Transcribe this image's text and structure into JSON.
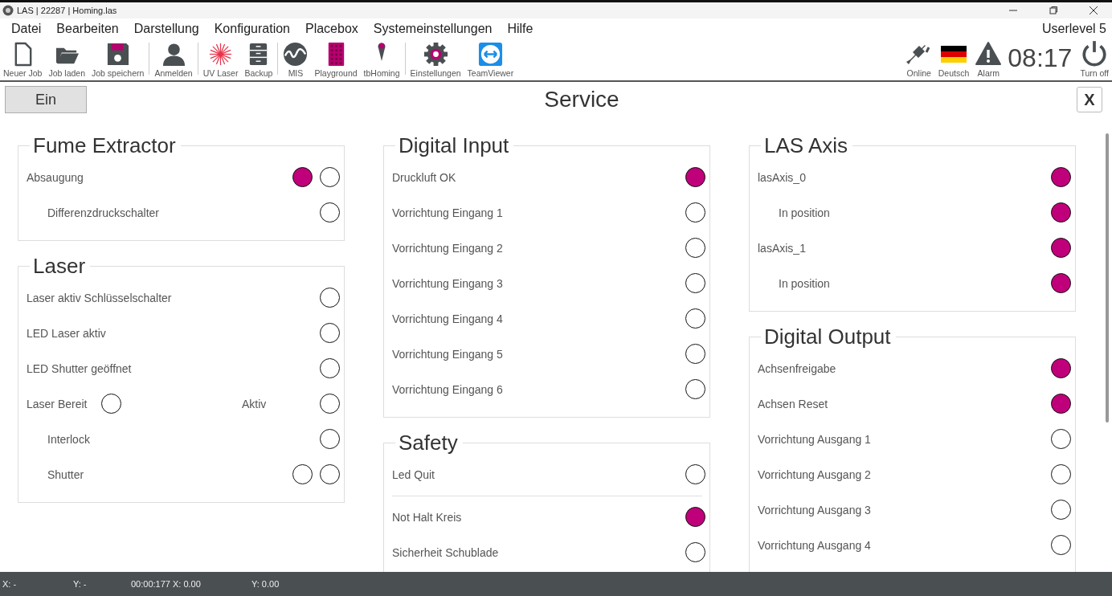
{
  "window": {
    "title": "LAS | 22287 | Homing.las"
  },
  "menu": [
    {
      "label": "Datei"
    },
    {
      "label": "Bearbeiten"
    },
    {
      "label": "Darstellung"
    },
    {
      "label": "Konfiguration"
    },
    {
      "label": "Placebox"
    },
    {
      "label": "Systemeinstellungen"
    },
    {
      "label": "Hilfe"
    }
  ],
  "userlevel": "Userlevel 5",
  "toolbar_groups": [
    [
      {
        "kind": "new",
        "label": "Neuer Job"
      },
      {
        "kind": "open",
        "label": "Job laden"
      },
      {
        "kind": "save",
        "label": "Job speichern"
      }
    ],
    [
      {
        "kind": "user",
        "label": "Anmelden"
      }
    ],
    [
      {
        "kind": "laser",
        "label": "UV Laser"
      },
      {
        "kind": "cabinet",
        "label": "Backup"
      }
    ],
    [
      {
        "kind": "mis",
        "label": "MIS"
      },
      {
        "kind": "grid",
        "label": "Playground"
      },
      {
        "kind": "pin",
        "label": "tbHoming"
      }
    ],
    [
      {
        "kind": "gear",
        "label": "Einstellungen"
      },
      {
        "kind": "remote",
        "label": "TeamViewer"
      }
    ]
  ],
  "status_icons": [
    {
      "kind": "online",
      "label": "Online"
    },
    {
      "kind": "flag",
      "label": "Deutsch"
    },
    {
      "kind": "alarm",
      "label": "Alarm"
    }
  ],
  "clock": "08:17",
  "turn_off": {
    "label": "Turn off"
  },
  "header": {
    "toggle": "Ein",
    "title": "Service",
    "close": "X"
  },
  "columns": [
    {
      "panels": [
        {
          "title": "Fume Extractor",
          "rows": [
            {
              "label": "Absaugung",
              "lamps": [
                {
                  "on": true
                },
                {
                  "on": false
                }
              ],
              "children": [
                {
                  "label": "Differenzdruckschalter",
                  "lamps": [
                    {
                      "on": false
                    }
                  ]
                }
              ]
            }
          ]
        },
        {
          "title": "Laser",
          "rows": [
            {
              "label": "Laser aktiv Schlüsselschalter",
              "lamps": [
                {
                  "on": false
                }
              ]
            },
            {
              "label": "LED Laser aktiv",
              "lamps": [
                {
                  "on": false
                }
              ]
            },
            {
              "label": "LED Shutter geöffnet",
              "lamps": [
                {
                  "on": false
                }
              ]
            },
            {
              "kind": "pair",
              "label": "Laser Bereit",
              "lamps": [
                {
                  "on": false
                }
              ],
              "second": {
                "label": "Aktiv",
                "lamps": [
                  {
                    "on": false
                  }
                ]
              },
              "children": [
                {
                  "label": "Interlock",
                  "lamps": [
                    {
                      "on": false
                    }
                  ]
                },
                {
                  "label": "Shutter",
                  "lamps": [
                    {
                      "on": false
                    },
                    {
                      "on": false
                    }
                  ]
                }
              ]
            }
          ]
        }
      ]
    },
    {
      "panels": [
        {
          "title": "Digital Input",
          "rows": [
            {
              "label": "Druckluft OK",
              "lamps": [
                {
                  "on": true
                }
              ]
            },
            {
              "label": "Vorrichtung Eingang 1",
              "lamps": [
                {
                  "on": false
                }
              ]
            },
            {
              "label": "Vorrichtung Eingang 2",
              "lamps": [
                {
                  "on": false
                }
              ]
            },
            {
              "label": "Vorrichtung Eingang 3",
              "lamps": [
                {
                  "on": false
                }
              ]
            },
            {
              "label": "Vorrichtung Eingang 4",
              "lamps": [
                {
                  "on": false
                }
              ]
            },
            {
              "label": "Vorrichtung Eingang 5",
              "lamps": [
                {
                  "on": false
                }
              ]
            },
            {
              "label": "Vorrichtung Eingang 6",
              "lamps": [
                {
                  "on": false
                }
              ]
            }
          ]
        },
        {
          "title": "Safety",
          "rows": [
            {
              "label": "Led Quit",
              "lamps": [
                {
                  "on": false
                }
              ],
              "divider_after": true
            },
            {
              "label": "Not Halt Kreis",
              "lamps": [
                {
                  "on": true
                }
              ]
            },
            {
              "label": "Sicherheit Schublade",
              "lamps": [
                {
                  "on": false
                }
              ]
            }
          ]
        }
      ]
    },
    {
      "panels": [
        {
          "title": "LAS Axis",
          "rows": [
            {
              "label": "lasAxis_0",
              "lamps": [
                {
                  "on": true
                }
              ],
              "children": [
                {
                  "label": "In position",
                  "lamps": [
                    {
                      "on": true
                    }
                  ]
                }
              ]
            },
            {
              "label": "lasAxis_1",
              "lamps": [
                {
                  "on": true
                }
              ],
              "children": [
                {
                  "label": "In position",
                  "lamps": [
                    {
                      "on": true
                    }
                  ]
                }
              ]
            }
          ]
        },
        {
          "title": "Digital Output",
          "rows": [
            {
              "label": "Achsenfreigabe",
              "lamps": [
                {
                  "on": true
                }
              ]
            },
            {
              "label": "Achsen Reset",
              "lamps": [
                {
                  "on": true
                }
              ]
            },
            {
              "label": "Vorrichtung Ausgang 1",
              "lamps": [
                {
                  "on": false
                }
              ]
            },
            {
              "label": "Vorrichtung Ausgang 2",
              "lamps": [
                {
                  "on": false
                }
              ]
            },
            {
              "label": "Vorrichtung Ausgang 3",
              "lamps": [
                {
                  "on": false
                }
              ]
            },
            {
              "label": "Vorrichtung Ausgang 4",
              "lamps": [
                {
                  "on": false
                }
              ]
            }
          ]
        }
      ]
    }
  ],
  "status_bar": [
    {
      "text": "X: -"
    },
    {
      "text": "Y: -"
    },
    {
      "text": "00:00:177"
    },
    {
      "text": "X: 0.00"
    },
    {
      "text": "Y: 0.00"
    }
  ]
}
